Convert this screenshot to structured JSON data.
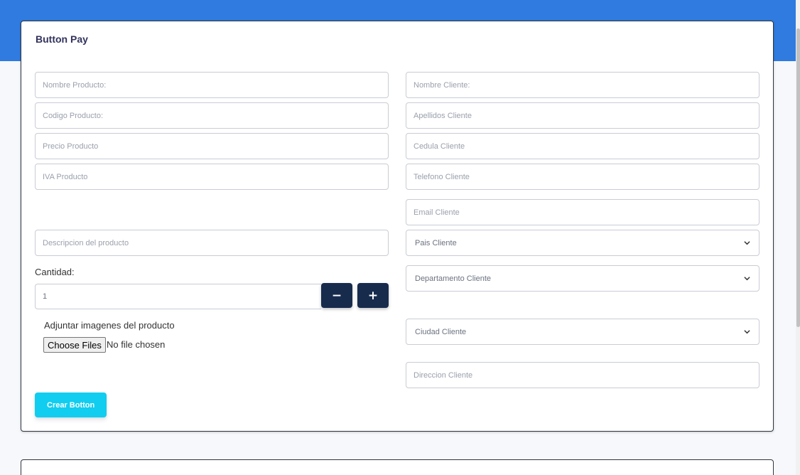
{
  "card": {
    "title": "Button Pay"
  },
  "product": {
    "nombre_placeholder": "Nombre Producto:",
    "codigo_placeholder": "Codigo Producto:",
    "precio_placeholder": "Precio Producto",
    "iva_placeholder": "IVA Producto",
    "descripcion_placeholder": "Descripcion del producto",
    "cantidad_label": "Cantidad:",
    "cantidad_value": "1",
    "minus_label": "−",
    "plus_label": "+",
    "adjuntar_label": "Adjuntar imagenes del producto",
    "choose_files_label": "Choose Files",
    "no_file_text": "No file chosen"
  },
  "client": {
    "nombre_placeholder": "Nombre Cliente:",
    "apellidos_placeholder": "Apellidos Cliente",
    "cedula_placeholder": "Cedula Cliente",
    "telefono_placeholder": "Telefono Cliente",
    "email_placeholder": "Email Cliente",
    "pais_selected": "Pais Cliente",
    "departamento_selected": "Departamento Cliente",
    "ciudad_selected": "Ciudad Cliente",
    "direccion_placeholder": "Direccion Cliente"
  },
  "actions": {
    "crear_label": "Crear Botton"
  },
  "icons": {
    "select_chevron": "chevron-down-icon"
  },
  "colors": {
    "header": "#2f7be0",
    "primary": "#11cdef",
    "dark_button": "#172b4d"
  }
}
